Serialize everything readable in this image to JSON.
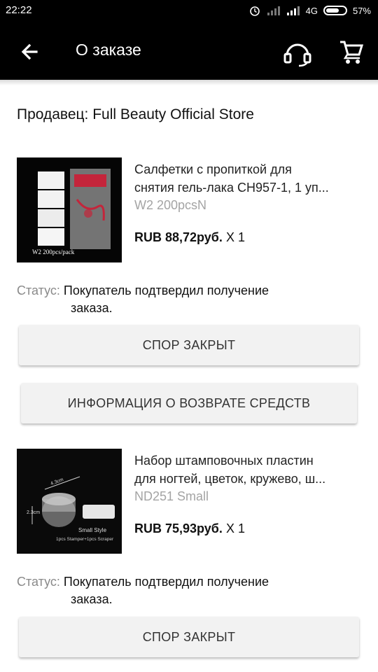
{
  "status_bar": {
    "time": "22:22",
    "network": "4G",
    "battery_percent": "57%",
    "battery_level": 0.57,
    "icons": [
      "alarm-icon",
      "signal-icon",
      "signal-icon",
      "battery-icon"
    ]
  },
  "header": {
    "title": "О заказе",
    "back_icon": "arrow-left-icon",
    "support_icon": "headset-icon",
    "cart_icon": "cart-icon"
  },
  "seller": "Продавец: Full Beauty Official Store",
  "items": [
    {
      "name_line1": "Салфетки с пропиткой для",
      "name_line2": "снятия гель-лака CH957-1, 1 уп...",
      "variant": "W2 200pcsN",
      "price": "RUB 88,72руб.",
      "qty": "X 1",
      "image_caption": "W2 200pcs/pack",
      "status_label": "Статус:",
      "status_line1": "Покупатель подтвердил получение",
      "status_line2": "заказа.",
      "buttons": [
        "СПОР ЗАКРЫТ",
        "ИНФОРМАЦИЯ О ВОЗВРАТЕ СРЕДСТВ"
      ]
    },
    {
      "name_line1": "Набор штамповочных пластин",
      "name_line2": "для ногтей, цветок, кружево, ш...",
      "variant": "ND251 Small",
      "price": "RUB 75,93руб.",
      "qty": "X 1",
      "image_caption_1": "Small Style",
      "image_caption_2": "1pcs Stamper+1pcs Scraper",
      "image_dim_1": "4.3cm",
      "image_dim_2": "2.3cm",
      "status_label": "Статус:",
      "status_line1": "Покупатель подтвердил получение",
      "status_line2": "заказа.",
      "buttons": [
        "СПОР ЗАКРЫТ"
      ]
    }
  ]
}
